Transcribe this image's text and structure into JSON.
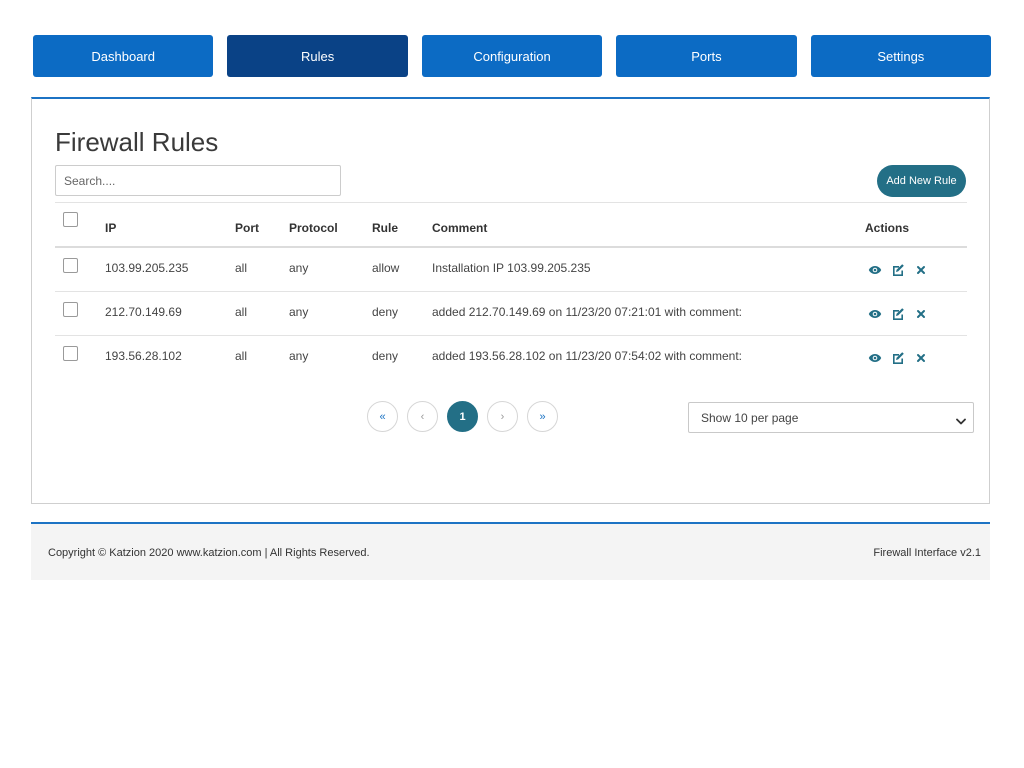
{
  "nav": {
    "items": [
      {
        "label": "Dashboard",
        "active": false
      },
      {
        "label": "Rules",
        "active": true
      },
      {
        "label": "Configuration",
        "active": false
      },
      {
        "label": "Ports",
        "active": false
      },
      {
        "label": "Settings",
        "active": false
      }
    ]
  },
  "panel": {
    "title": "Firewall Rules",
    "search_placeholder": "Search....",
    "add_button_label": "Add New Rule"
  },
  "table": {
    "headers": {
      "ip": "IP",
      "port": "Port",
      "protocol": "Protocol",
      "rule": "Rule",
      "comment": "Comment",
      "actions": "Actions"
    },
    "rows": [
      {
        "ip": "103.99.205.235",
        "port": "all",
        "protocol": "any",
        "rule": "allow",
        "comment": "Installation IP 103.99.205.235"
      },
      {
        "ip": "212.70.149.69",
        "port": "all",
        "protocol": "any",
        "rule": "deny",
        "comment": "added 212.70.149.69 on 11/23/20 07:21:01 with comment:"
      },
      {
        "ip": "193.56.28.102",
        "port": "all",
        "protocol": "any",
        "rule": "deny",
        "comment": "added 193.56.28.102 on 11/23/20 07:54:02 with comment:"
      }
    ]
  },
  "pagination": {
    "first": "«",
    "prev": "‹",
    "current": "1",
    "next": "›",
    "last": "»",
    "per_page": "Show 10 per page"
  },
  "footer": {
    "copyright": "Copyright © Katzion 2020 www.katzion.com | All Rights Reserved.",
    "version": "Firewall Interface v2.1"
  },
  "colors": {
    "nav_primary": "#0c6bc4",
    "nav_active": "#0a4286",
    "accent_teal": "#236f86",
    "action_icons": "#236f86"
  },
  "icons": {
    "view": "eye-icon",
    "edit": "edit-icon",
    "delete": "close-icon",
    "dropdown": "chevron-down-icon"
  }
}
